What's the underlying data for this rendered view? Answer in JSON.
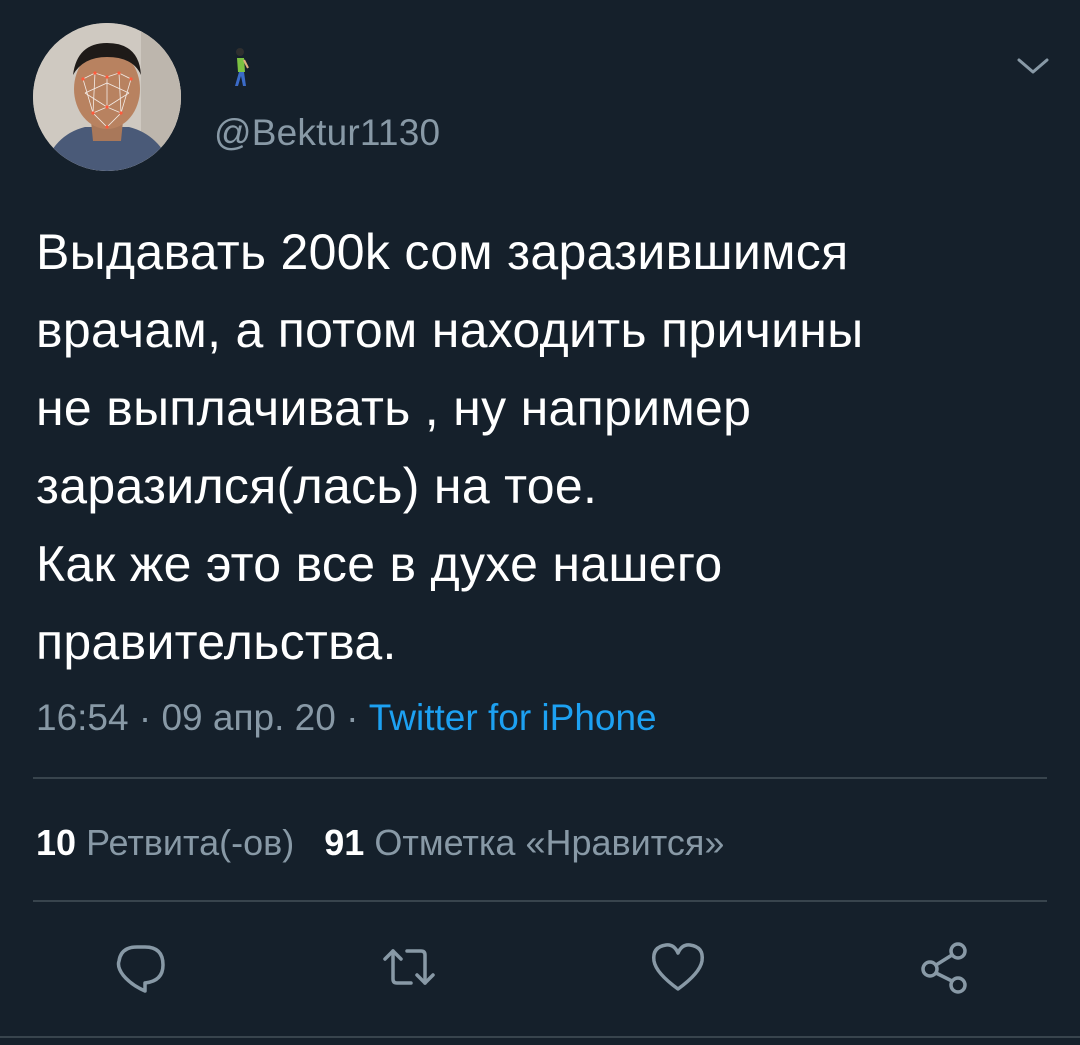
{
  "tweet": {
    "username": "@Bektur1130",
    "text": "Выдавать 200k сом заразившимся\nврачам, а потом находить причины\nне выплачивать , ну например\nзаразился(лась) на тое.\nКак же это все в духе нашего\nправительства.",
    "time": "16:54",
    "date": "09 апр. 20",
    "separator": " · ",
    "source": "Twitter for iPhone"
  },
  "stats": {
    "retweets_count": "10",
    "retweets_label": "Ретвита(-ов)",
    "likes_count": "91",
    "likes_label": "Отметка «Нравится»"
  },
  "icons": {
    "display_name_emoji": "person-walking-icon",
    "more": "chevron-down-icon",
    "reply": "reply-icon",
    "retweet": "retweet-icon",
    "like": "heart-icon",
    "share": "share-icon"
  },
  "colors": {
    "background": "#15202b",
    "secondary_text": "#8899a6",
    "link": "#1da1f2",
    "divider": "#38444d"
  }
}
